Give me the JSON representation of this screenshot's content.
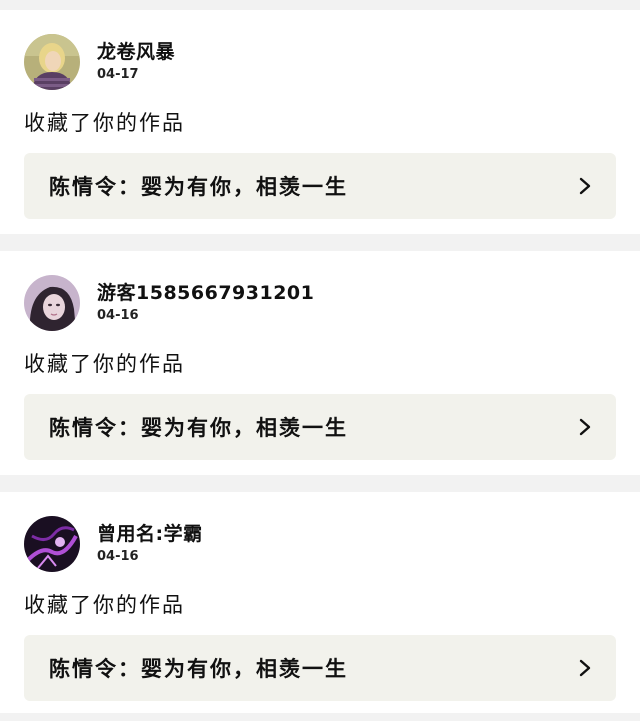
{
  "notifications": [
    {
      "username": "龙卷风暴",
      "date": "04-17",
      "action_text": "收藏了你的作品",
      "work_title": "陈情令：婴为有你，相羡一生",
      "avatar_icon": "avatar-blonde-girl"
    },
    {
      "username": "游客1585667931201",
      "date": "04-16",
      "action_text": "收藏了你的作品",
      "work_title": "陈情令：婴为有你，相羡一生",
      "avatar_icon": "avatar-girl-purple"
    },
    {
      "username": "曾用名:学霸",
      "date": "04-16",
      "action_text": "收藏了你的作品",
      "work_title": "陈情令：婴为有你，相羡一生",
      "avatar_icon": "avatar-purple-abstract"
    }
  ],
  "colors": {
    "page_background": "#f2f2f2",
    "card_background": "#ffffff",
    "work_box_background": "#f2f2ec"
  }
}
